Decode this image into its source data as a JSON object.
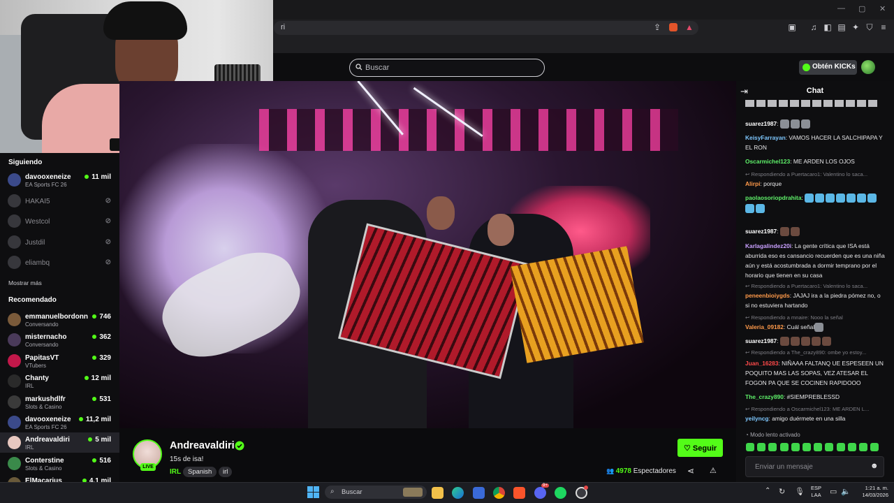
{
  "browser": {
    "address": "ri"
  },
  "header": {
    "search_placeholder": "Buscar",
    "kicks_label": "Obtén KICKs"
  },
  "sidebar": {
    "following_title": "Siguiendo",
    "following": [
      {
        "name": "davooxeneize",
        "category": "EA Sports FC 26",
        "viewers": "11 mil",
        "live": true,
        "avatar_color": "#3b4a8a"
      },
      {
        "name": "HAKAI5",
        "category": "",
        "viewers": "",
        "live": false,
        "avatar_color": "#5a5a60"
      },
      {
        "name": "Westcol",
        "category": "",
        "viewers": "",
        "live": false,
        "avatar_color": "#5a5a60"
      },
      {
        "name": "Justdil",
        "category": "",
        "viewers": "",
        "live": false,
        "avatar_color": "#5a5a60"
      },
      {
        "name": "eliambq",
        "category": "",
        "viewers": "",
        "live": false,
        "avatar_color": "#5a5a60"
      }
    ],
    "show_more": "Mostrar más",
    "recommended_title": "Recomendado",
    "recommended": [
      {
        "name": "emmanuelbordonn",
        "category": "Conversando",
        "viewers": "746",
        "avatar_color": "#7a5a3a"
      },
      {
        "name": "misternacho",
        "category": "Conversando",
        "viewers": "362",
        "avatar_color": "#4a3a5a"
      },
      {
        "name": "PapitasVT",
        "category": "VTubers",
        "viewers": "329",
        "avatar_color": "#c2184a"
      },
      {
        "name": "Chanty",
        "category": "IRL",
        "viewers": "12 mil",
        "avatar_color": "#2a2a2a"
      },
      {
        "name": "markushdlfr",
        "category": "Slots & Casino",
        "viewers": "531",
        "avatar_color": "#3a3a3a"
      },
      {
        "name": "davooxeneize",
        "category": "EA Sports FC 26",
        "viewers": "11,2 mil",
        "avatar_color": "#3b4a8a"
      },
      {
        "name": "Andreavaldiri",
        "category": "IRL",
        "viewers": "5 mil",
        "avatar_color": "#e8c8c0",
        "active": true
      },
      {
        "name": "Conterstine",
        "category": "Slots & Casino",
        "viewers": "516",
        "avatar_color": "#3a8a4a"
      },
      {
        "name": "ElMacarius",
        "category": "",
        "viewers": "4,1 mil",
        "avatar_color": "#6a5a3a"
      }
    ]
  },
  "stream": {
    "channel": "Andreavaldiri",
    "title": "15s de isa!",
    "category": "IRL",
    "tags": [
      "Spanish",
      "irl"
    ],
    "live_badge": "LIVE",
    "follow_label": "Seguir",
    "viewers": "4978",
    "viewers_label": "Espectadores"
  },
  "chat": {
    "title": "Chat",
    "messages": [
      {
        "type": "msg",
        "user": "suarez1987",
        "color": "#ffffff",
        "text": "",
        "emotes": 3,
        "emote_style": "grey"
      },
      {
        "type": "msg",
        "user": "KeisyFarrayan",
        "color": "#7ec8ff",
        "text": "VAMOS HACER LA SALCHIPAPA Y EL RON"
      },
      {
        "type": "msg",
        "user": "Oscarmichel123",
        "color": "#5ff26a",
        "text": "ME ARDEN LOS OJOS"
      },
      {
        "type": "reply",
        "text": "Respondiendo a Puertacaro1: Valentino lo saca..."
      },
      {
        "type": "msg",
        "user": "Alirpi",
        "color": "#ff9a4a",
        "text": "porque"
      },
      {
        "type": "msg",
        "user": "paolaosoriopdrahita",
        "color": "#5ff26a",
        "text": "",
        "emotes": 9,
        "emote_style": "blue"
      },
      {
        "type": "msg",
        "user": "suarez1987",
        "color": "#ffffff",
        "text": "",
        "emotes": 2,
        "emote_style": "dark"
      },
      {
        "type": "msg",
        "user": "Karlagalindez20i",
        "color": "#c9a0ff",
        "text": "La gente crítica que ISA está aburrida eso es cansancio recuerden que es una niña aún y está acostumbrada a dormir temprano por el horario que tienen en su casa"
      },
      {
        "type": "reply",
        "text": "Respondiendo a Puertacaro1: Valentino lo saca..."
      },
      {
        "type": "msg",
        "user": "peneenbioiygds",
        "color": "#ff9a4a",
        "text": "JAJAJ ira a la piedra pómez no, o si no estuviera hartando"
      },
      {
        "type": "reply",
        "text": "Respondiendo a mnaire: Nooo la señal"
      },
      {
        "type": "msg",
        "user": "Valeria_09182",
        "color": "#ff9a4a",
        "text": "Cuál señal",
        "emotes": 1,
        "emote_style": "grey"
      },
      {
        "type": "msg",
        "user": "suarez1987",
        "color": "#ffffff",
        "text": "",
        "emotes": 5,
        "emote_style": "dark"
      },
      {
        "type": "reply",
        "text": "Respondiendo a The_crazy890: ombe yo estoy..."
      },
      {
        "type": "msg",
        "user": "Juan_16283",
        "color": "#ff4a4a",
        "text": "NIÑAAA FALTANQ UE ESPESEEN UN POQUITO MAS LAS SOPAS, VEZ ATESAR EL FOGON PA QUE SE COCINEN RAPIDOOO"
      },
      {
        "type": "msg",
        "user": "The_crazy890",
        "color": "#5ff26a",
        "text": "#SIEMPREBLESSD"
      },
      {
        "type": "reply",
        "text": "Respondiendo a Oscarmichel123: ME ARDEN L..."
      },
      {
        "type": "msg",
        "user": "yeilyncg",
        "color": "#7ec8ff",
        "text": "amigo duérmete en una silla"
      }
    ],
    "slow_mode": "Modo lento activado",
    "input_placeholder": "Enviar un mensaje"
  },
  "taskbar": {
    "search_placeholder": "Buscar",
    "lang_top": "ESP",
    "lang_bottom": "LAA",
    "time": "1:21 a. m.",
    "date": "14/03/2026",
    "discord_badge": "9+"
  }
}
